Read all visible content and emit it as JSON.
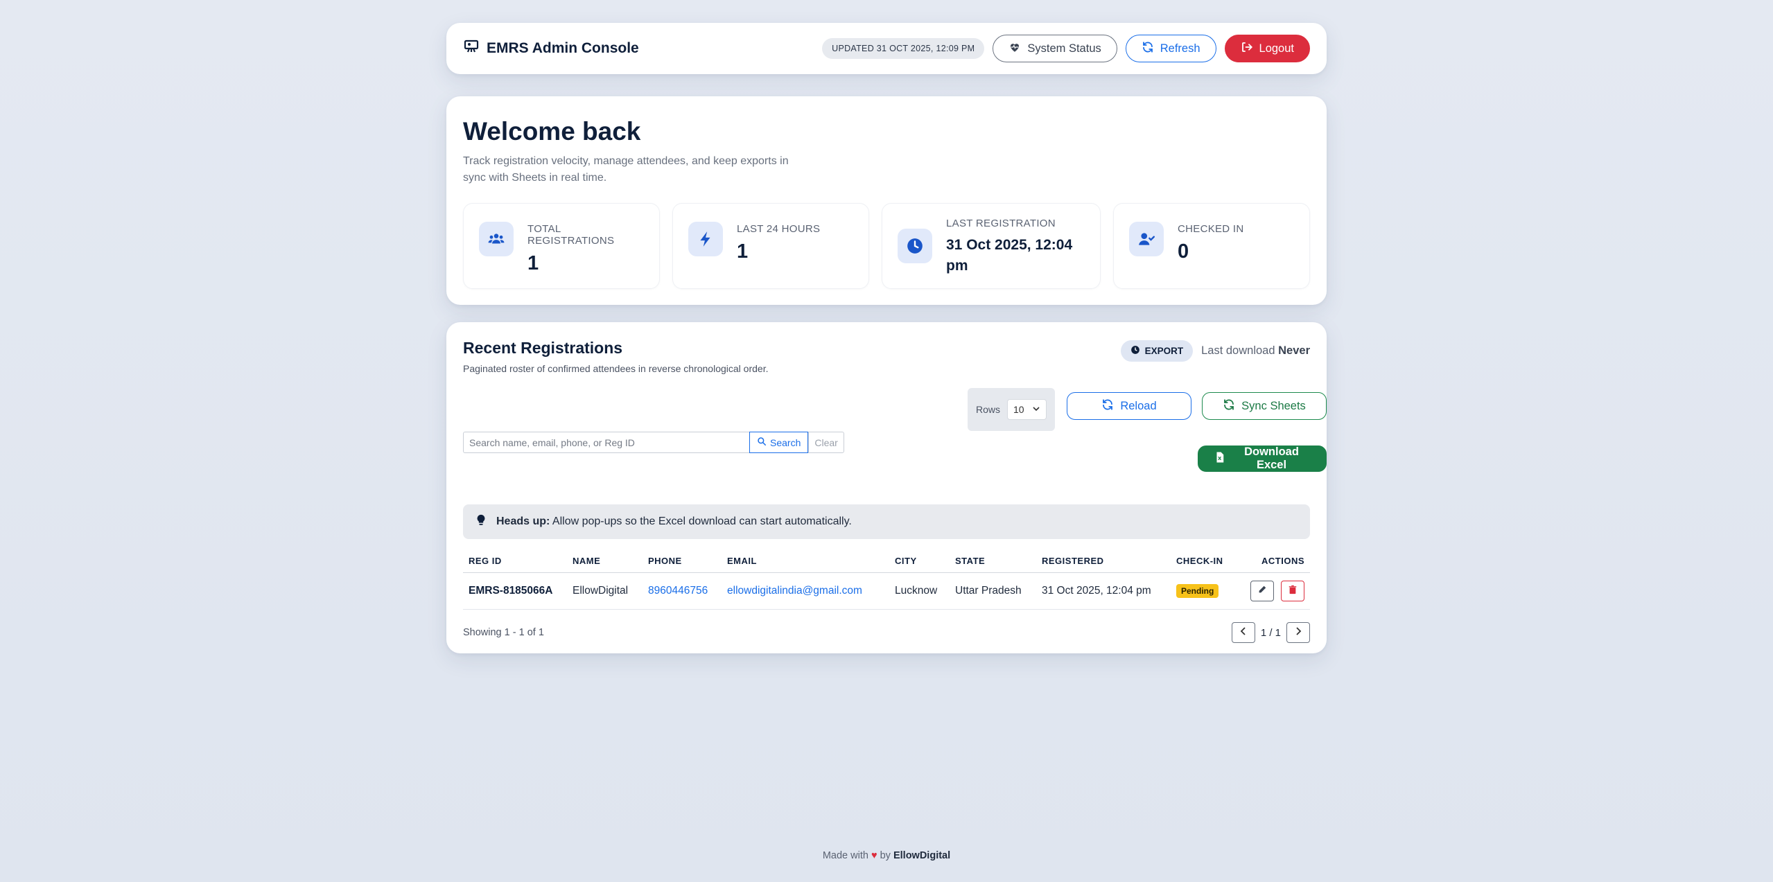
{
  "header": {
    "brand": "EMRS Admin Console",
    "updated": "UPDATED 31 OCT 2025, 12:09 PM",
    "system_status": "System Status",
    "refresh": "Refresh",
    "logout": "Logout"
  },
  "welcome": {
    "title": "Welcome back",
    "subtitle": "Track registration velocity, manage attendees, and keep exports in sync with Sheets in real time.",
    "stats": [
      {
        "label": "TOTAL REGISTRATIONS",
        "value": "1",
        "icon": "users-icon"
      },
      {
        "label": "LAST 24 HOURS",
        "value": "1",
        "icon": "bolt-icon"
      },
      {
        "label": "LAST REGISTRATION",
        "value": "31 Oct 2025, 12:04 pm",
        "icon": "clock-icon"
      },
      {
        "label": "CHECKED IN",
        "value": "0",
        "icon": "user-check-icon"
      }
    ]
  },
  "registrations": {
    "title": "Recent Registrations",
    "subtitle": "Paginated roster of confirmed attendees in reverse chronological order.",
    "export_label": "EXPORT",
    "last_download_label": "Last download",
    "last_download_value": "Never",
    "search_placeholder": "Search name, email, phone, or Reg ID",
    "search_button": "Search",
    "clear_button": "Clear",
    "rows_label": "Rows",
    "rows_value": "10",
    "reload": "Reload",
    "sync": "Sync Sheets",
    "download": "Download Excel",
    "headsup_bold": "Heads up:",
    "headsup_text": " Allow pop-ups so the Excel download can start automatically.",
    "columns": [
      "REG ID",
      "NAME",
      "PHONE",
      "EMAIL",
      "CITY",
      "STATE",
      "REGISTERED",
      "CHECK-IN",
      "ACTIONS"
    ],
    "rows": [
      {
        "reg_id": "EMRS-8185066A",
        "name": "EllowDigital",
        "phone": "8960446756",
        "email": "ellowdigitalindia@gmail.com",
        "city": "Lucknow",
        "state": "Uttar Pradesh",
        "registered": "31 Oct 2025, 12:04 pm",
        "checkin": "Pending"
      }
    ],
    "showing": "Showing 1 - 1 of 1",
    "page": "1 / 1"
  },
  "footer": {
    "made_with": "Made with",
    "by": "by",
    "author": "EllowDigital"
  },
  "colors": {
    "accent": "#1a6ee8",
    "danger": "#dc2d3d",
    "success": "#1a8048",
    "warning": "#f7c21a"
  }
}
